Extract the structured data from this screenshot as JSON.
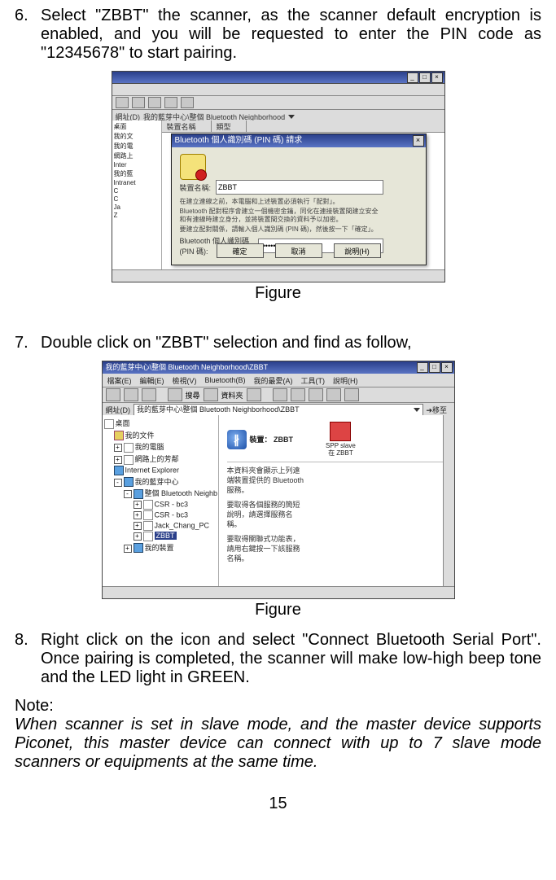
{
  "step6": {
    "num": "6.",
    "text": "Select \"ZBBT\" the scanner, as the scanner default encryption is enabled, and you will be requested to enter the PIN code as \"12345678\" to start pairing."
  },
  "figure_label": "Figure",
  "step7": {
    "num": "7.",
    "text": "Double click on \"ZBBT\" selection and find as follow,"
  },
  "step8": {
    "num": "8.",
    "text": "Right click on the icon and select \"Connect Bluetooth Serial Port\". Once pairing is completed, the scanner will make low-high beep tone and the LED light in GREEN."
  },
  "note_label": "Note:",
  "note_body": "When scanner is set in slave mode, and the master device supports Piconet, this master device can connect with up to 7 slave mode scanners or equipments at the same time.",
  "page_number": "15",
  "fig1": {
    "addr_label": "網址(D)",
    "addr_value": "我的藍芽中心\\整個 Bluetooth Neighborhood",
    "list_col1": "裝置名稱",
    "list_col2": "類型",
    "tree": [
      "桌面",
      "我的文",
      "我的電",
      "網路上",
      "Inter",
      "我的藍",
      "Intranet",
      "C",
      "C",
      "Ja",
      "Z"
    ],
    "dialog": {
      "title": "Bluetooth 個人識別碼 (PIN 碼) 請求",
      "dev_label": "裝置名稱:",
      "dev_value": "ZBBT",
      "para1": "在建立連線之前，本電腦和上述裝置必須執行「配對」。",
      "para2": "Bluetooth 配對程序會建立一個機密金鑰，同化在連接裝置間建立安全和有連線時建立身分，並將裝置間交換的資料予以加密。",
      "para3": "要建立配對關係，請輸入個人識別碼 (PIN 碼)，然後按一下「確定」。",
      "pin_label": "Bluetooth 個人識別碼\n(PIN 碼):",
      "btn_ok": "確定",
      "btn_cancel": "取消",
      "btn_help": "說明(H)"
    }
  },
  "fig2": {
    "title": "我的藍芽中心\\整個 Bluetooth Neighborhood\\ZBBT",
    "menu": [
      "檔案(E)",
      "編輯(E)",
      "檢視(V)",
      "Bluetooth(B)",
      "我的最愛(A)",
      "工具(T)",
      "說明(H)"
    ],
    "toolbar_search": "搜尋",
    "toolbar_folders": "資料夾",
    "addr_label": "網址(D)",
    "addr_value": "我的藍芽中心\\整個 Bluetooth Neighborhood\\ZBBT",
    "go_label": "移至",
    "tree": {
      "root": "桌面",
      "items": [
        "我的文件",
        "我的電腦",
        "網路上的芳鄰",
        "Internet Explorer",
        "我的藍芽中心"
      ],
      "sub": "整個 Bluetooth Neighb",
      "leaves": [
        "CSR - bc3",
        "CSR - bc3",
        "Jack_Chang_PC",
        "ZBBT"
      ],
      "last": "我的裝置"
    },
    "content": {
      "device_label": "裝置：",
      "device_name": "ZBBT",
      "spp_line1": "SPP slave",
      "spp_line2": "在 ZBBT",
      "p1a": "本資料夾會顯示上列遠",
      "p1b": "端裝置提供的 Bluetooth",
      "p1c": "服務。",
      "p2a": "要取得各個服務的簡短",
      "p2b": "說明，請選擇服務名",
      "p2c": "稱。",
      "p3a": "要取得關聯式功能表，",
      "p3b": "請用右鍵按一下該服務",
      "p3c": "名稱。"
    }
  }
}
